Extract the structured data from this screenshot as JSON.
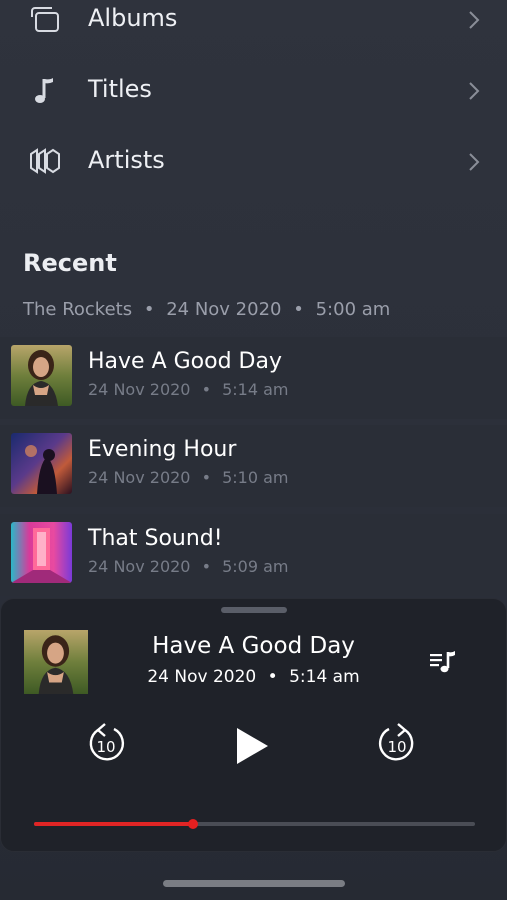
{
  "library": {
    "items": [
      {
        "label": "Albums",
        "icon": "albums-icon"
      },
      {
        "label": "Titles",
        "icon": "music-note-icon"
      },
      {
        "label": "Artists",
        "icon": "artists-icon"
      }
    ]
  },
  "recent": {
    "title": "Recent",
    "source": "The Rockets",
    "source_date": "24 Nov 2020",
    "source_time": "5:00 am",
    "separator": "•",
    "tracks": [
      {
        "title": "Have A Good Day",
        "date": "24 Nov 2020",
        "time": "5:14 am"
      },
      {
        "title": "Evening Hour",
        "date": "24 Nov 2020",
        "time": "5:10 am"
      },
      {
        "title": "That Sound!",
        "date": "24 Nov 2020",
        "time": "5:09 am"
      }
    ]
  },
  "player": {
    "title": "Have A Good Day",
    "date": "24 Nov 2020",
    "time": "5:14 am",
    "skip_back_seconds": "10",
    "skip_forward_seconds": "10",
    "progress_fraction": 0.36,
    "progress_color": "#e02525"
  },
  "colors": {
    "background": "#2c303a",
    "sheet": "#1f2229",
    "accent": "#e02525",
    "muted_text": "#777c88"
  }
}
